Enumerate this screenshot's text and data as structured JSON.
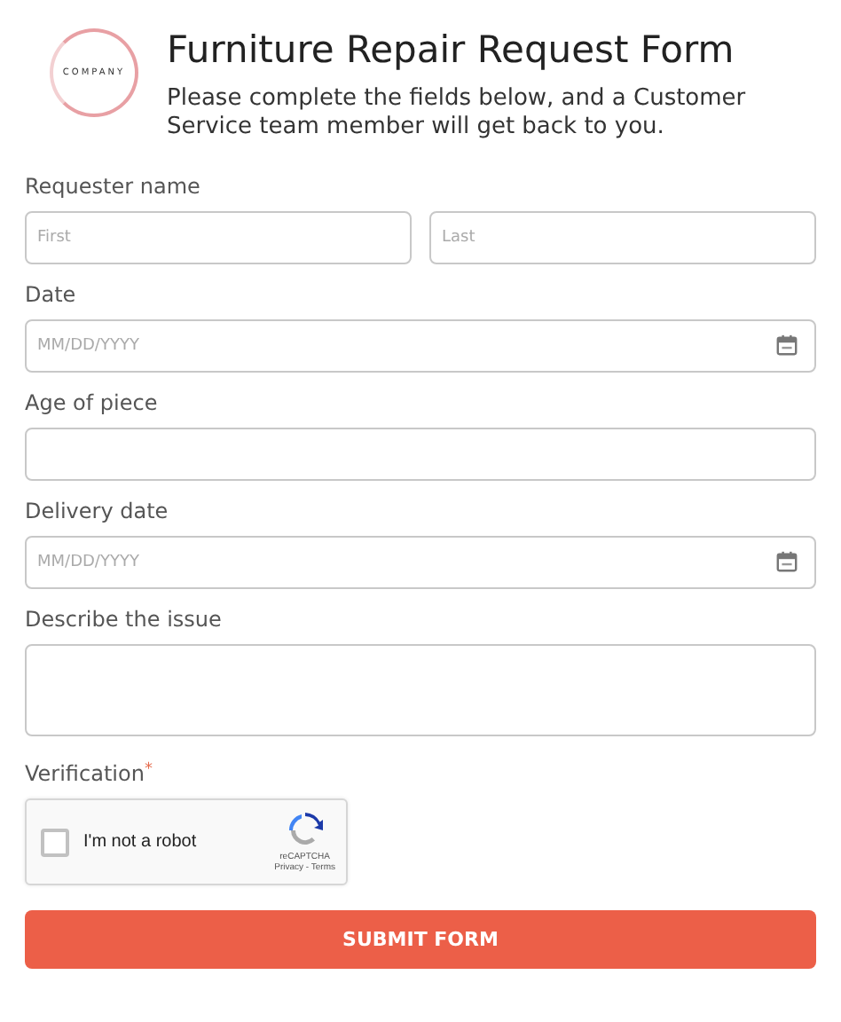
{
  "logo": {
    "text": "COMPANY"
  },
  "header": {
    "title": "Furniture Repair Request Form",
    "subtitle": "Please complete the fields below, and a Customer Service team member will get back to you."
  },
  "fields": [
    {
      "kind": "name",
      "label": "Requester name",
      "placeholders": [
        "First",
        "Last"
      ]
    },
    {
      "kind": "date",
      "label": "Date",
      "placeholder": "MM/DD/YYYY"
    },
    {
      "kind": "text",
      "label": "Age of piece"
    },
    {
      "kind": "date",
      "label": "Delivery date",
      "placeholder": "MM/DD/YYYY"
    },
    {
      "kind": "textarea",
      "label": "Describe the issue"
    }
  ],
  "verification": {
    "label": "Verification",
    "required_mark": "*",
    "captcha": {
      "checked": false,
      "label": "I'm not a robot",
      "brand": "reCAPTCHA",
      "links": "Privacy - Terms"
    }
  },
  "submit": "SUBMIT FORM"
}
